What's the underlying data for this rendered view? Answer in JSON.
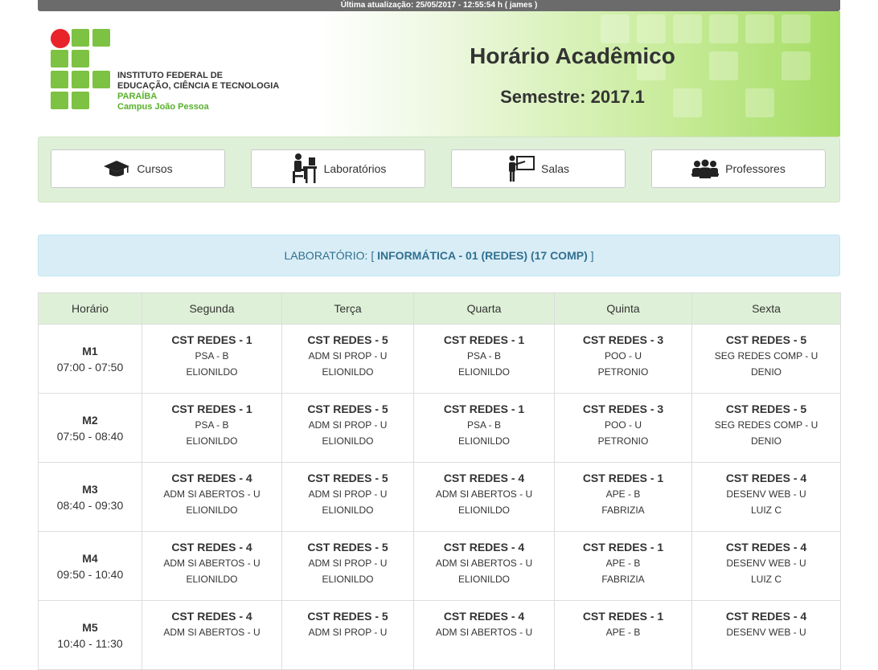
{
  "topbar": {
    "text": "Última atualização: 25/05/2017 - 12:55:54 h ( james )"
  },
  "header": {
    "institution": [
      "INSTITUTO FEDERAL DE",
      "EDUCAÇÃO, CIÊNCIA E TECNOLOGIA"
    ],
    "state": "PARAÍBA",
    "campus": "Campus João Pessoa",
    "title": "Horário Acadêmico",
    "semester": "Semestre: 2017.1"
  },
  "nav": {
    "cursos": {
      "label": "Cursos",
      "icon": "graduation-cap-icon"
    },
    "laboratorios": {
      "label": "Laboratórios",
      "icon": "computer-desk-icon"
    },
    "salas": {
      "label": "Salas",
      "icon": "presenter-board-icon"
    },
    "professores": {
      "label": "Professores",
      "icon": "group-icon"
    }
  },
  "info": {
    "prefix": "LABORATÓRIO: [",
    "lab": "INFORMÁTICA - 01 (REDES) (17 COMP)",
    "suffix": "]"
  },
  "colors": {
    "green_brand": "#7dc242",
    "red_brand": "#e8232a",
    "header_bg": "#dff0d8",
    "info_bg": "#d9edf7",
    "info_text": "#31708f"
  },
  "table": {
    "headers": [
      "Horário",
      "Segunda",
      "Terça",
      "Quarta",
      "Quinta",
      "Sexta"
    ],
    "rows": [
      {
        "code": "M1",
        "time": "07:00 - 07:50",
        "cells": [
          {
            "course": "CST REDES - 1",
            "subject": "PSA - B",
            "teacher": "ELIONILDO"
          },
          {
            "course": "CST REDES - 5",
            "subject": "ADM SI PROP - U",
            "teacher": "ELIONILDO"
          },
          {
            "course": "CST REDES - 1",
            "subject": "PSA - B",
            "teacher": "ELIONILDO"
          },
          {
            "course": "CST REDES - 3",
            "subject": "POO - U",
            "teacher": "PETRONIO"
          },
          {
            "course": "CST REDES - 5",
            "subject": "SEG REDES COMP - U",
            "teacher": "DENIO"
          }
        ]
      },
      {
        "code": "M2",
        "time": "07:50 - 08:40",
        "cells": [
          {
            "course": "CST REDES - 1",
            "subject": "PSA - B",
            "teacher": "ELIONILDO"
          },
          {
            "course": "CST REDES - 5",
            "subject": "ADM SI PROP - U",
            "teacher": "ELIONILDO"
          },
          {
            "course": "CST REDES - 1",
            "subject": "PSA - B",
            "teacher": "ELIONILDO"
          },
          {
            "course": "CST REDES - 3",
            "subject": "POO - U",
            "teacher": "PETRONIO"
          },
          {
            "course": "CST REDES - 5",
            "subject": "SEG REDES COMP - U",
            "teacher": "DENIO"
          }
        ]
      },
      {
        "code": "M3",
        "time": "08:40 - 09:30",
        "cells": [
          {
            "course": "CST REDES - 4",
            "subject": "ADM SI ABERTOS - U",
            "teacher": "ELIONILDO"
          },
          {
            "course": "CST REDES - 5",
            "subject": "ADM SI PROP - U",
            "teacher": "ELIONILDO"
          },
          {
            "course": "CST REDES - 4",
            "subject": "ADM SI ABERTOS - U",
            "teacher": "ELIONILDO"
          },
          {
            "course": "CST REDES - 1",
            "subject": "APE - B",
            "teacher": "FABRIZIA"
          },
          {
            "course": "CST REDES - 4",
            "subject": "DESENV WEB - U",
            "teacher": "LUIZ C"
          }
        ]
      },
      {
        "code": "M4",
        "time": "09:50 - 10:40",
        "cells": [
          {
            "course": "CST REDES - 4",
            "subject": "ADM SI ABERTOS - U",
            "teacher": "ELIONILDO"
          },
          {
            "course": "CST REDES - 5",
            "subject": "ADM SI PROP - U",
            "teacher": "ELIONILDO"
          },
          {
            "course": "CST REDES - 4",
            "subject": "ADM SI ABERTOS - U",
            "teacher": "ELIONILDO"
          },
          {
            "course": "CST REDES - 1",
            "subject": "APE - B",
            "teacher": "FABRIZIA"
          },
          {
            "course": "CST REDES - 4",
            "subject": "DESENV WEB - U",
            "teacher": "LUIZ C"
          }
        ]
      },
      {
        "code": "M5",
        "time": "10:40 - 11:30",
        "cells": [
          {
            "course": "CST REDES - 4",
            "subject": "ADM SI ABERTOS - U",
            "teacher": ""
          },
          {
            "course": "CST REDES - 5",
            "subject": "ADM SI PROP - U",
            "teacher": ""
          },
          {
            "course": "CST REDES - 4",
            "subject": "ADM SI ABERTOS - U",
            "teacher": ""
          },
          {
            "course": "CST REDES - 1",
            "subject": "APE - B",
            "teacher": ""
          },
          {
            "course": "CST REDES - 4",
            "subject": "DESENV WEB - U",
            "teacher": ""
          }
        ]
      }
    ]
  }
}
